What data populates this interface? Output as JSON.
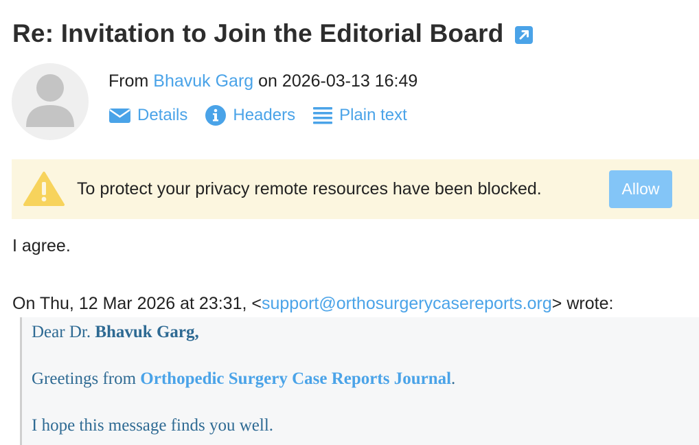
{
  "message": {
    "subject": "Re: Invitation to Join the Editorial Board",
    "from_prefix": "From",
    "sender_name": "Bhavuk Garg",
    "date_prefix": "on",
    "date": "2026-03-13 16:49"
  },
  "actions": [
    {
      "label": "Details",
      "icon": "envelope-icon"
    },
    {
      "label": "Headers",
      "icon": "info-icon"
    },
    {
      "label": "Plain text",
      "icon": "lines-icon"
    }
  ],
  "privacy_warning": {
    "text": "To protect your privacy remote resources have been blocked.",
    "button": "Allow",
    "icon": "warning-icon"
  },
  "body": {
    "reply": "I agree.",
    "quote_header_prefix": "On Thu, 12 Mar 2026 at 23:31, <",
    "quote_email": "support@orthosurgerycasereports.org",
    "quote_header_suffix": "> wrote:",
    "quoted": {
      "greeting_prefix": "Dear Dr. ",
      "greeting_name": "Bhavuk Garg,",
      "line2_prefix": "Greetings from ",
      "journal": "Orthopedic Surgery Case Reports Journal",
      "line2_suffix": ".",
      "line3": "I hope this message finds you well."
    }
  },
  "colors": {
    "link": "#4aa3e8",
    "warning_bg": "#fcf6df",
    "warning_icon": "#f7d35c",
    "allow_button": "#83c5f7",
    "quote_text": "#2e6a93"
  }
}
